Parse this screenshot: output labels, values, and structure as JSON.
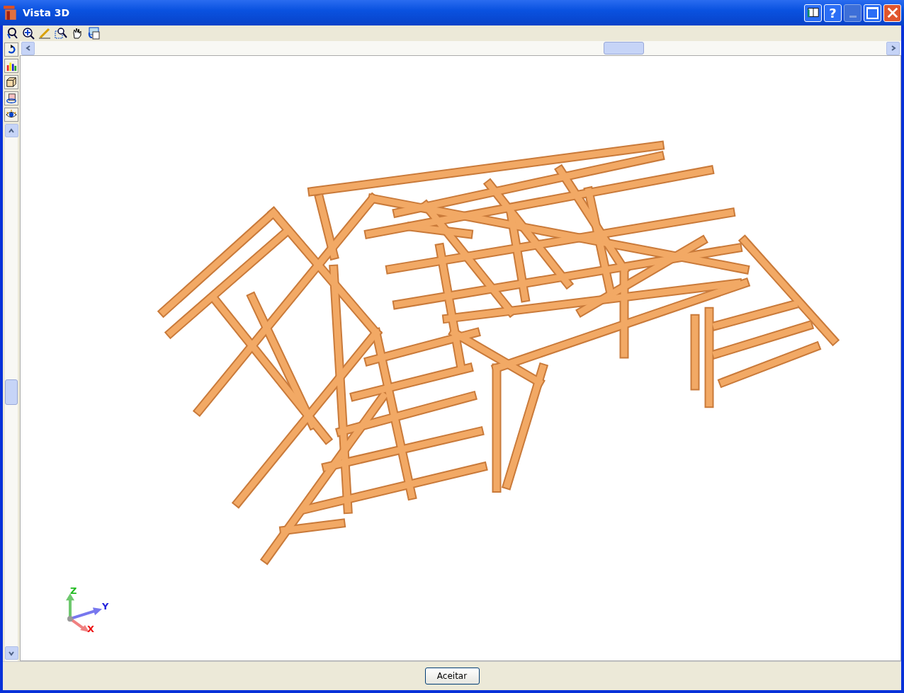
{
  "window": {
    "title": "Vista 3D",
    "help_button": "?"
  },
  "axes": {
    "z": "Z",
    "y": "Y",
    "x": "X"
  },
  "footer": {
    "button": "Aceitar"
  }
}
